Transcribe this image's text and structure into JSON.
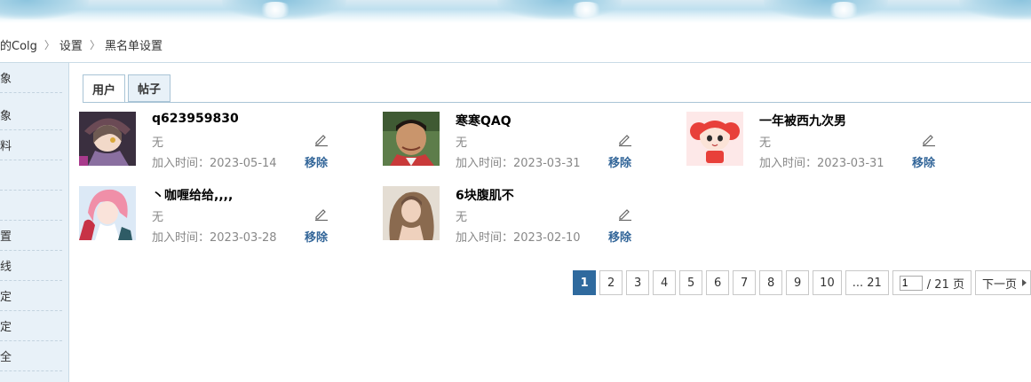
{
  "breadcrumb": {
    "home": "的Colg",
    "settings": "设置",
    "current": "黑名单设置"
  },
  "sidebar": {
    "items": [
      "象",
      "料",
      "",
      "",
      "置",
      "线",
      "定",
      "定",
      "全"
    ]
  },
  "tabs": [
    {
      "label": "用户"
    },
    {
      "label": "帖子"
    }
  ],
  "blacklist": [
    {
      "name": "q623959830",
      "note": "无",
      "added": "加入时间：2023-05-14",
      "action": "移除"
    },
    {
      "name": "寒寒QAQ",
      "note": "无",
      "added": "加入时间：2023-03-31",
      "action": "移除"
    },
    {
      "name": "一年被西九次男",
      "note": "无",
      "added": "加入时间：2023-03-31",
      "action": "移除"
    },
    {
      "name": "丶咖喱给给,,,,",
      "note": "无",
      "added": "加入时间：2023-03-28",
      "action": "移除"
    },
    {
      "name": "6块腹肌不",
      "note": "无",
      "added": "加入时间：2023-02-10",
      "action": "移除"
    }
  ],
  "pagination": {
    "pages": [
      "1",
      "2",
      "3",
      "4",
      "5",
      "6",
      "7",
      "8",
      "9",
      "10"
    ],
    "current": "1",
    "last": "... 21",
    "jump_value": "1",
    "total": "/ 21 页",
    "next": "下一页"
  },
  "colors": {
    "accent": "#2f6a9e",
    "link": "#336699",
    "sidebar_bg": "#e8f1f8"
  }
}
